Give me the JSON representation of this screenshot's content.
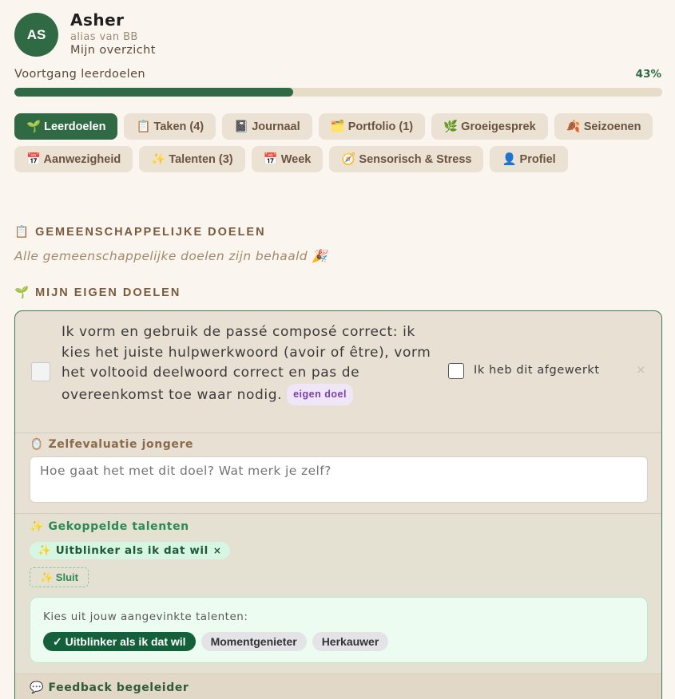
{
  "profile": {
    "initials": "AS",
    "name": "Asher",
    "alias": "alias van BB",
    "subtitle": "Mijn overzicht"
  },
  "progress": {
    "label": "Voortgang leerdoelen",
    "percent_label": "43%",
    "value": 0.43
  },
  "tabs": [
    {
      "label": "🌱 Leerdoelen",
      "active": true
    },
    {
      "label": "📋 Taken (4)"
    },
    {
      "label": "📓 Journaal"
    },
    {
      "label": "🗂️ Portfolio (1)"
    },
    {
      "label": "🌿 Groeigesprek"
    },
    {
      "label": "🍂 Seizoenen"
    },
    {
      "label": "📅 Aanwezigheid"
    },
    {
      "label": "✨ Talenten (3)"
    },
    {
      "label": "📅 Week"
    },
    {
      "label": "🧭 Sensorisch & Stress"
    },
    {
      "label": "👤 Profiel"
    }
  ],
  "shared_goals": {
    "title": "📋 GEMEENSCHAPPELIJKE DOELEN",
    "empty_text": "Alle gemeenschappelijke doelen zijn behaald 🎉"
  },
  "own_goals": {
    "title": "🌱 MIJN EIGEN DOELEN",
    "goal": {
      "text": "Ik vorm en gebruik de passé composé correct: ik kies het juiste hulpwerkwoord (avoir of être), vorm het voltooid deelwoord correct en pas de overeenkomst toe waar nodig.",
      "badge": "eigen doel",
      "done_label": "Ik heb dit afgewerkt",
      "close": "×",
      "self_eval": {
        "title": "🪞 Zelfevaluatie jongere",
        "placeholder": "Hoe gaat het met dit doel? Wat merk je zelf?"
      },
      "talents": {
        "title": "✨ Gekoppelde talenten",
        "linked": "✨ Uitblinker als ik dat wil",
        "remove": "×",
        "close_button": "✨ Sluit",
        "picker_label": "Kies uit jouw aangevinkte talenten:",
        "options": [
          {
            "label": "✓ Uitblinker als ik dat wil",
            "selected": true
          },
          {
            "label": "Momentgenieter"
          },
          {
            "label": "Herkauwer"
          }
        ]
      },
      "feedback": {
        "title": "💬 Feedback begeleider"
      }
    }
  }
}
